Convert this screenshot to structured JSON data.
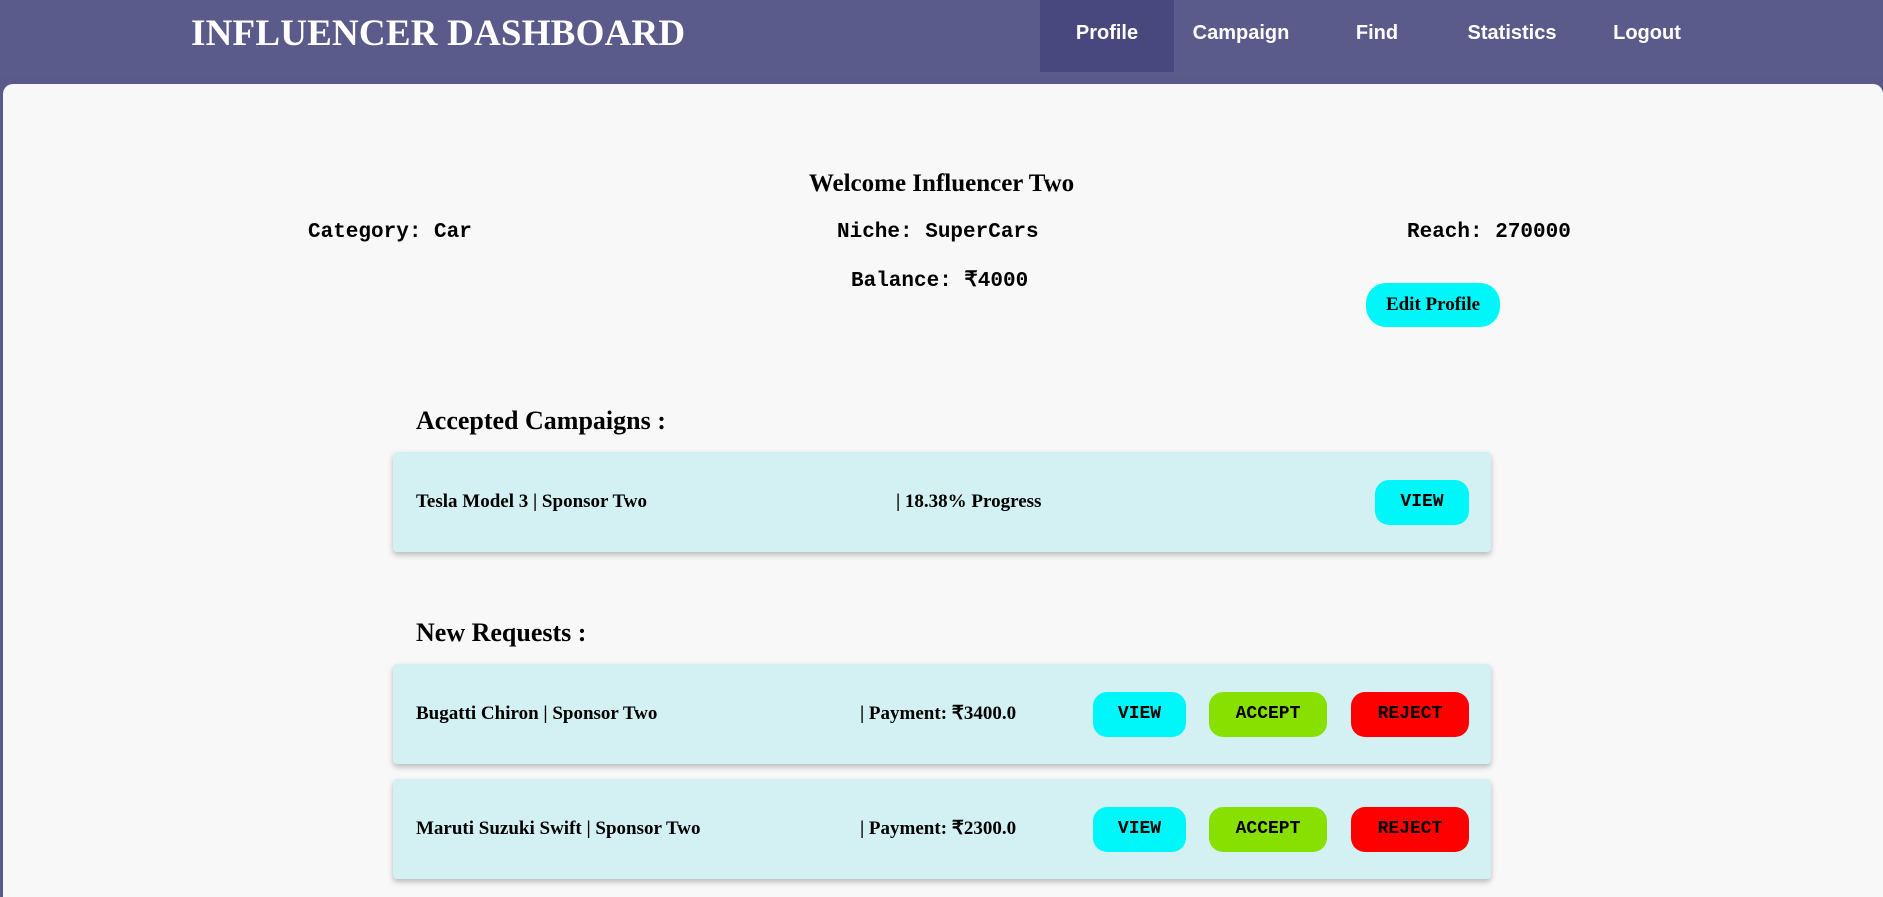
{
  "header": {
    "brand": "INFLUENCER DASHBOARD",
    "nav": [
      "Profile",
      "Campaign",
      "Find",
      "Statistics",
      "Logout"
    ],
    "active_nav": "Profile"
  },
  "profile": {
    "welcome": "Welcome Influencer Two",
    "category": "Category: Car",
    "niche": "Niche: SuperCars",
    "reach": "Reach: 270000",
    "balance": "Balance: ₹4000",
    "edit_label": "Edit Profile"
  },
  "accepted": {
    "title": "Accepted Campaigns :",
    "items": [
      {
        "name": "Tesla Model 3 | Sponsor Two",
        "progress": "| 18.38% Progress",
        "view_label": "VIEW"
      }
    ]
  },
  "requests": {
    "title": "New Requests :",
    "items": [
      {
        "name": "Bugatti Chiron | Sponsor Two",
        "payment": "| Payment: ₹3400.0",
        "view_label": "VIEW",
        "accept_label": "ACCEPT",
        "reject_label": "REJECT"
      },
      {
        "name": "Maruti Suzuki Swift | Sponsor Two",
        "payment": "| Payment: ₹2300.0",
        "view_label": "VIEW",
        "accept_label": "ACCEPT",
        "reject_label": "REJECT"
      }
    ]
  },
  "colors": {
    "navbar": "#5b5b8b",
    "nav_active": "#48487e",
    "card": "#d3f1f3",
    "view": "#00f7f9",
    "accept": "#88e000",
    "reject": "#ff0000"
  }
}
